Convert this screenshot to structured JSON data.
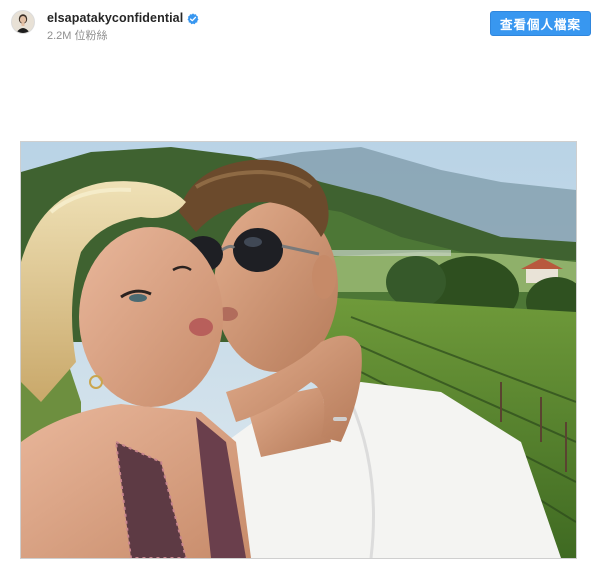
{
  "post": {
    "username": "elsapatakyconfidential",
    "verified": true,
    "followers": "2.2M 位粉絲",
    "view_profile_label": "查看個人檔案",
    "avatar_icon": "profile-avatar",
    "verified_icon": "verified-badge-icon"
  },
  "colors": {
    "accent": "#3897f0",
    "text_primary": "#262626",
    "text_secondary": "#8e8e8e"
  },
  "photo": {
    "scene": "selfie-kiss-vineyard",
    "has_caption": false
  }
}
